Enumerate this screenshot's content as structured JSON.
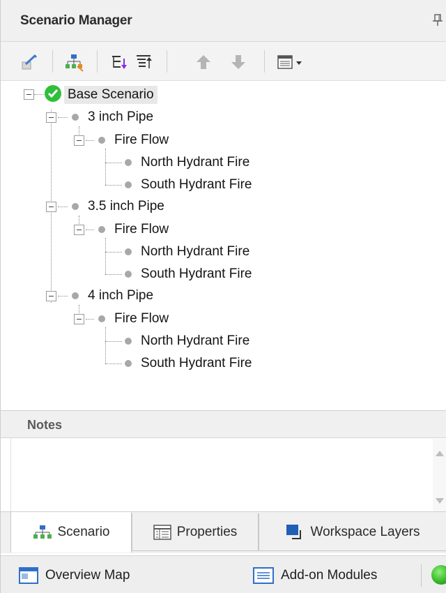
{
  "panel": {
    "title": "Scenario Manager"
  },
  "toolbar": {
    "buttons": [
      {
        "name": "edit-scenario-icon"
      },
      {
        "name": "create-child-scenario-icon"
      },
      {
        "name": "expand-tree-icon"
      },
      {
        "name": "collapse-tree-icon"
      },
      {
        "name": "move-up-icon"
      },
      {
        "name": "move-down-icon"
      },
      {
        "name": "view-options-icon"
      }
    ]
  },
  "tree": {
    "root": "Base Scenario",
    "items": [
      {
        "label": "3 inch Pipe"
      },
      {
        "label": "Fire Flow"
      },
      {
        "label": "North Hydrant Fire"
      },
      {
        "label": "South Hydrant Fire"
      },
      {
        "label": "3.5 inch Pipe"
      },
      {
        "label": "Fire Flow"
      },
      {
        "label": "North Hydrant Fire"
      },
      {
        "label": "South Hydrant Fire"
      },
      {
        "label": "4 inch Pipe"
      },
      {
        "label": "Fire Flow"
      },
      {
        "label": "North Hydrant Fire"
      },
      {
        "label": "South Hydrant Fire"
      }
    ]
  },
  "notes": {
    "label": "Notes",
    "value": ""
  },
  "tabs": [
    {
      "label": "Scenario",
      "active": true
    },
    {
      "label": "Properties",
      "active": false
    },
    {
      "label": "Workspace Layers",
      "active": false
    }
  ],
  "statusbar": {
    "overview": "Overview Map",
    "addons": "Add-on Modules"
  },
  "colors": {
    "accent_blue": "#1f5fb5",
    "check_green": "#2fbf3a",
    "status_green": "#3ab82a"
  }
}
